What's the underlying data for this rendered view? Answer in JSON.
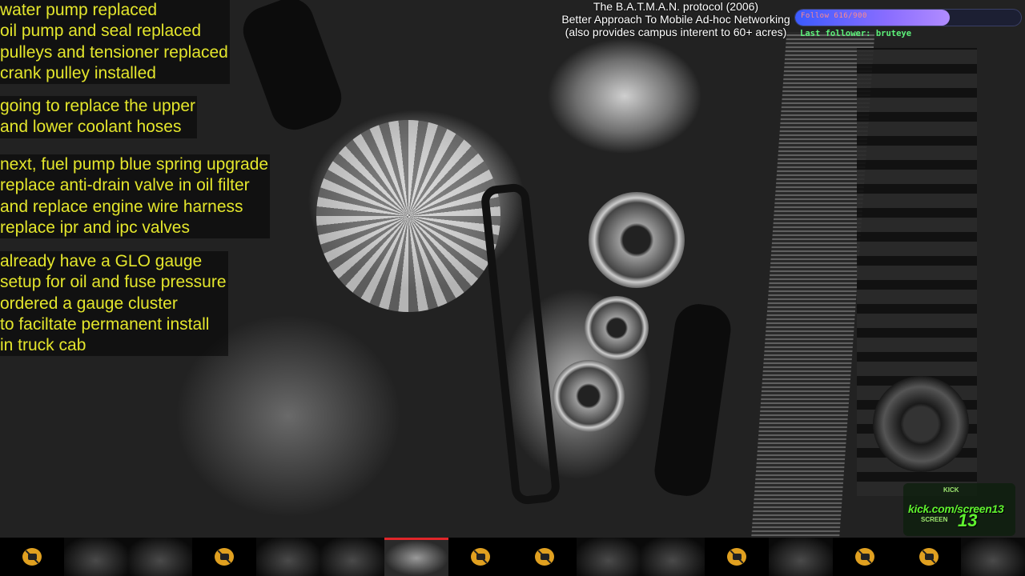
{
  "notes": {
    "block1": [
      "water pump replaced",
      "oil pump and seal replaced",
      "pulleys and tensioner replaced",
      "crank pulley installed"
    ],
    "block2": [
      "going to replace the upper",
      "and lower coolant hoses"
    ],
    "block3": [
      "next, fuel pump blue spring upgrade",
      "replace anti-drain valve in oil filter",
      "and replace engine wire harness",
      "replace ipr and ipc valves"
    ],
    "block4": [
      "already have a GLO gauge",
      "setup for oil and fuse pressure",
      "ordered a gauge cluster",
      "to faciltate permanent install",
      "in truck cab"
    ]
  },
  "banner": {
    "line1": "The B.A.T.M.A.N. protocol (2006)",
    "line2": "Better Approach To Mobile Ad-hoc Networking",
    "line3": "(also provides campus interent to 60+ acres)"
  },
  "follow_goal": {
    "label": "Follow 616/900",
    "progress": 0.684,
    "last_follower": "Last follower: bruteye"
  },
  "kick": {
    "small": "KICK",
    "url": "kick.com/screen13",
    "brand": "SCREEN",
    "num": "13"
  },
  "camera_strip": {
    "tiles": [
      "off",
      "live",
      "live",
      "off",
      "live",
      "live",
      "active",
      "off",
      "off",
      "live",
      "live",
      "off",
      "live",
      "off",
      "off",
      "live"
    ]
  }
}
